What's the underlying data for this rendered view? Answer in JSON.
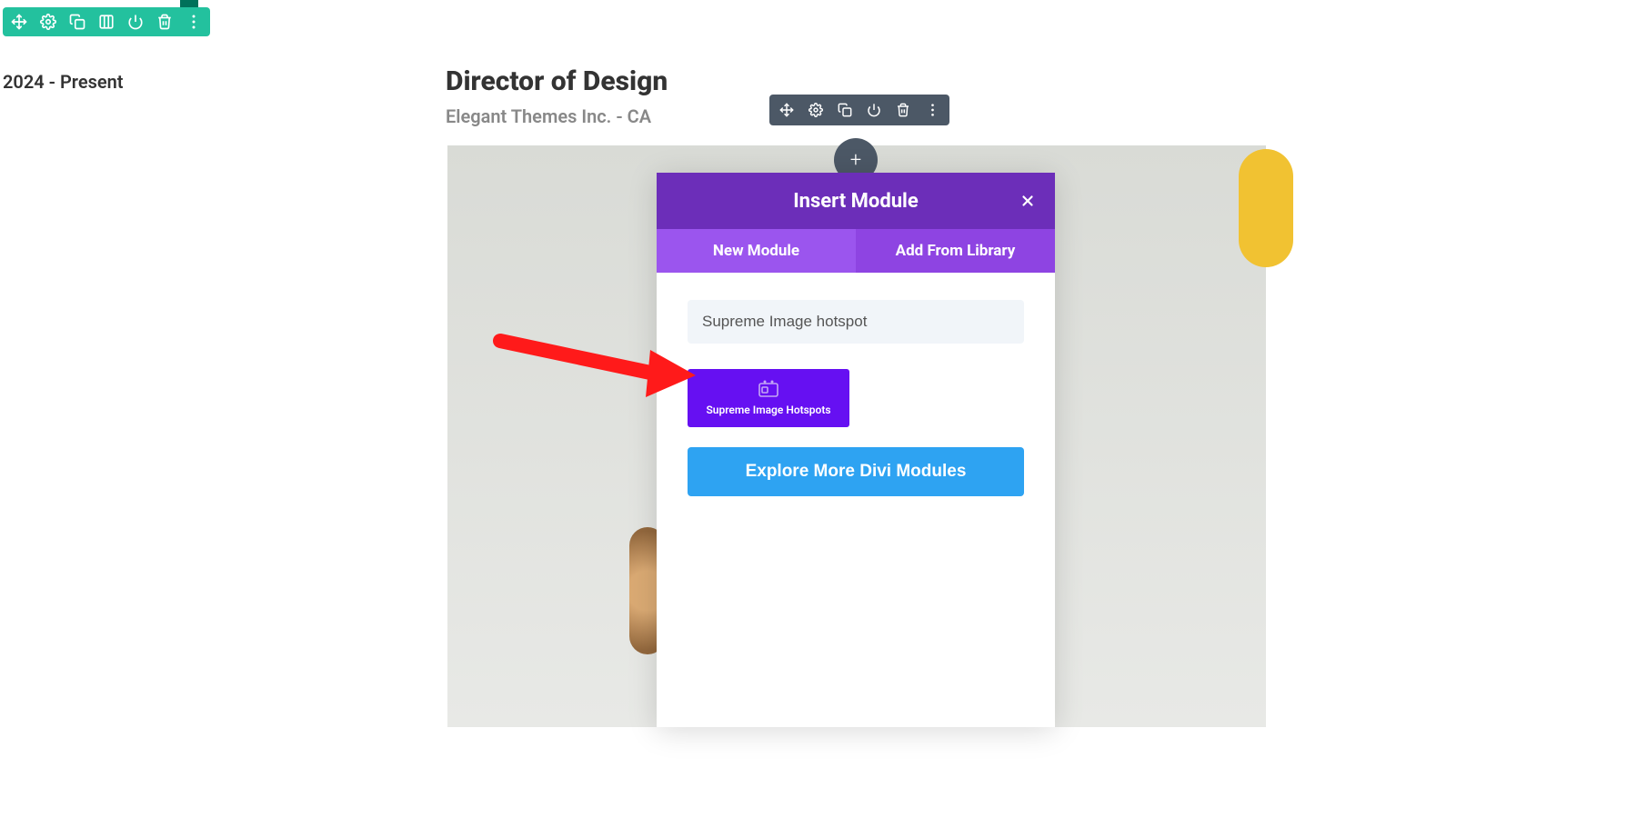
{
  "left": {
    "date_text": "2024 - Present"
  },
  "job": {
    "title": "Director of Design",
    "subtitle": "Elegant Themes Inc. - CA"
  },
  "add_button": {
    "label": "+"
  },
  "modal": {
    "title": "Insert Module",
    "tabs": {
      "new_module": "New Module",
      "add_from_library": "Add From Library"
    },
    "search_value": "Supreme Image hotspot",
    "module_card_label": "Supreme Image Hotspots",
    "explore_button": "Explore More Divi Modules"
  },
  "icons": {
    "move": "move-icon",
    "gear": "gear-icon",
    "duplicate": "duplicate-icon",
    "columns": "columns-icon",
    "power": "power-icon",
    "trash": "trash-icon",
    "more": "more-icon",
    "close": "close-icon"
  }
}
